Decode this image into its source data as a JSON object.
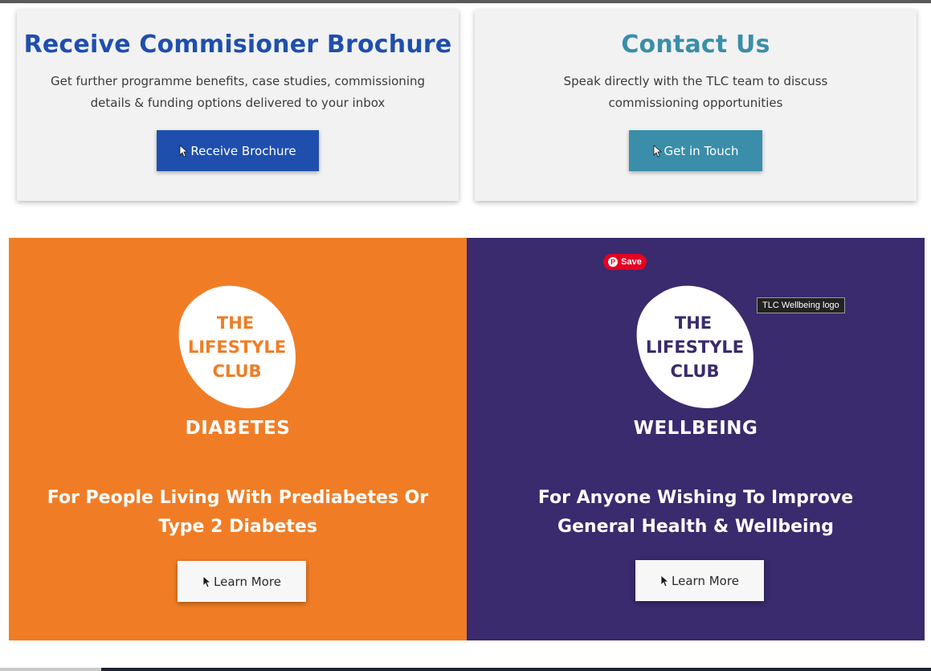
{
  "brochure_card": {
    "title": "Receive Commisioner Brochure",
    "description": "Get further programme benefits, case studies, commissioning details & funding options delivered to your inbox",
    "button_label": "Receive Brochure",
    "title_color": "#1f4fad",
    "button_color": "#1f4fad"
  },
  "contact_card": {
    "title": "Contact Us",
    "description": "Speak directly with the TLC team to discuss commissioning opportunities",
    "button_label": "Get in Touch",
    "title_color": "#3a8eaa",
    "button_color": "#3a8eaa"
  },
  "diabetes_panel": {
    "logo_lines": [
      "THE",
      "LIFESTYLE",
      "CLUB"
    ],
    "logo_sub": "DIABETES",
    "tagline": "For People Living With Prediabetes Or Type 2 Diabetes",
    "button_label": "Learn More",
    "background": "#f07d26"
  },
  "wellbeing_panel": {
    "logo_lines": [
      "THE",
      "LIFESTYLE",
      "CLUB"
    ],
    "logo_sub": "WELLBEING",
    "tagline": "For Anyone Wishing To Improve General Health & Wellbeing",
    "button_label": "Learn More",
    "background": "#3a2a6e"
  },
  "pinterest": {
    "save_label": "Save",
    "icon": "pinterest-icon"
  },
  "tooltip": {
    "text": "TLC Wellbeing logo"
  },
  "icons": {
    "cursor": "cursor-arrow-icon"
  }
}
